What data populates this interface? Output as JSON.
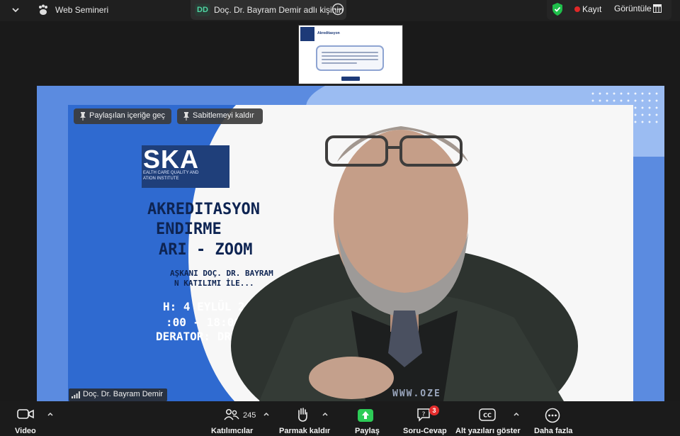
{
  "topbar": {
    "title": "Web Semineri",
    "speaker_initials": "DD",
    "speaker_text": "Doç. Dr. Bayram Demir adlı kişinin",
    "record_label": "Kayıt",
    "view_label": "Görüntüle"
  },
  "thumbnail": {
    "title": "Akreditasyon"
  },
  "slide": {
    "logo": "SKA",
    "logo_sub1": "EALTH CARE QUALITY AND",
    "logo_sub2": "ATION INSTITUTE",
    "line1": "AKREDITASYON",
    "line2": "ENDIRME",
    "line3": "ARI - ZOOM",
    "line4": "AŞKANI DOÇ. DR. BAYRAM",
    "line5": "N KATILIMI İLE...",
    "line6": "H: 4 EYLÜL 2025",
    "line7": ":00 - 18:00",
    "line8": "DERATOR: DR",
    "url": "WWW.OZE"
  },
  "pinned": {
    "shared_content": "Paylaşılan içeriğe geç",
    "unpin": "Sabitlemeyi kaldır"
  },
  "participant_name": "Doç. Dr. Bayram Demir",
  "toolbar": {
    "video": "Video",
    "participants": "Katılımcılar",
    "participants_count": "245",
    "raise_hand": "Parmak kaldır",
    "share": "Paylaş",
    "qa": "Soru-Cevap",
    "qa_badge": "3",
    "captions": "Alt yazıları göster",
    "more": "Daha fazla"
  },
  "colors": {
    "stage_blue": "#5b8be0",
    "slide_blue": "#2f6ad0",
    "share_green": "#2dcc57",
    "record_red": "#e02828",
    "shield_green": "#1fbf4b"
  },
  "icons": [
    "chevron-down-icon",
    "paw-icon",
    "more-icon",
    "shield-icon",
    "view-grid-icon",
    "pin-icon",
    "signal-icon",
    "video-icon",
    "participants-icon",
    "hand-icon",
    "share-icon",
    "qa-icon",
    "cc-icon",
    "more-circle-icon"
  ]
}
